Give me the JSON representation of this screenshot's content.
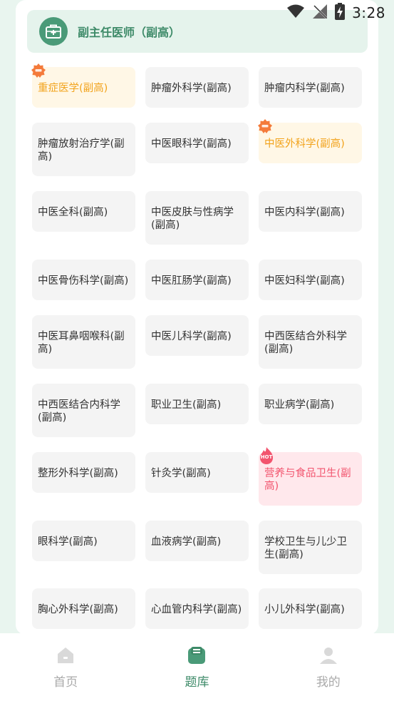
{
  "status_bar": {
    "time": "3:28"
  },
  "header": {
    "title": "副主任医师（副高）",
    "icon": "medical-kit-icon"
  },
  "subjects": [
    {
      "label": "重症医学(副高)",
      "badge": "recommend"
    },
    {
      "label": "肿瘤外科学(副高)"
    },
    {
      "label": "肿瘤内科学(副高)"
    },
    {
      "label": "肿瘤放射治疗学(副高)"
    },
    {
      "label": "中医眼科学(副高)"
    },
    {
      "label": "中医外科学(副高)",
      "badge": "recommend"
    },
    {
      "label": "中医全科(副高)"
    },
    {
      "label": "中医皮肤与性病学(副高)"
    },
    {
      "label": "中医内科学(副高)"
    },
    {
      "label": "中医骨伤科学(副高)"
    },
    {
      "label": "中医肛肠学(副高)"
    },
    {
      "label": "中医妇科学(副高)"
    },
    {
      "label": "中医耳鼻咽喉科(副高)"
    },
    {
      "label": "中医儿科学(副高)"
    },
    {
      "label": "中西医结合外科学(副高)"
    },
    {
      "label": "中西医结合内科学(副高)"
    },
    {
      "label": "职业卫生(副高)"
    },
    {
      "label": "职业病学(副高)"
    },
    {
      "label": "整形外科学(副高)"
    },
    {
      "label": "针灸学(副高)"
    },
    {
      "label": "营养与食品卫生(副高)",
      "badge": "hot"
    },
    {
      "label": "眼科学(副高)"
    },
    {
      "label": "血液病学(副高)"
    },
    {
      "label": "学校卫生与儿少卫生(副高)"
    },
    {
      "label": "胸心外科学(副高)"
    },
    {
      "label": "心血管内科学(副高)"
    },
    {
      "label": "小儿外科学(副高)"
    }
  ],
  "badges": {
    "hot_text": "HOT"
  },
  "colors": {
    "accent": "#3d8a68",
    "featured_text": "#f2a31c",
    "hot_text": "#f2546e",
    "tile_bg": "#f4f4f4"
  },
  "nav": {
    "items": [
      {
        "label": "首页",
        "icon": "home-icon",
        "active": false
      },
      {
        "label": "题库",
        "icon": "question-bank-icon",
        "active": true
      },
      {
        "label": "我的",
        "icon": "profile-icon",
        "active": false
      }
    ]
  }
}
